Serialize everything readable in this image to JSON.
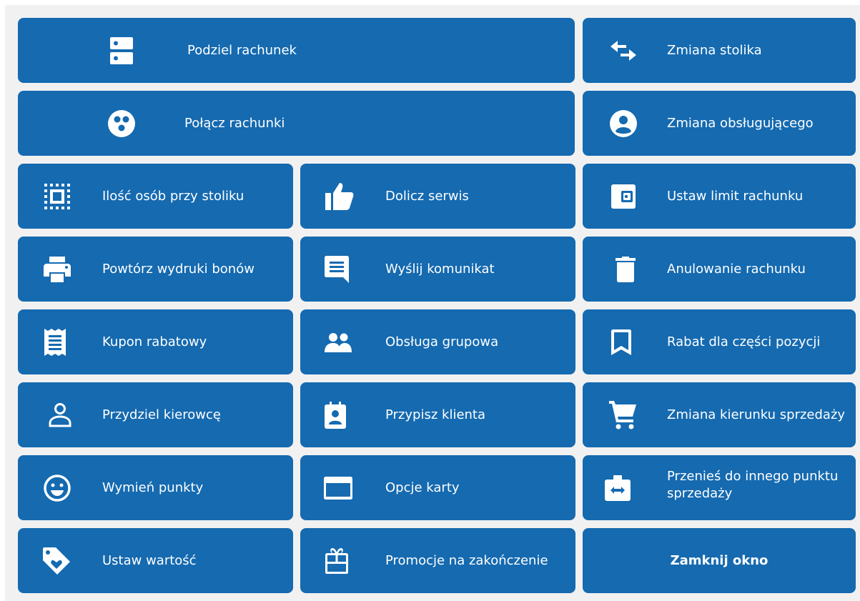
{
  "accent": "#156ab0",
  "tiles": {
    "split_bill": {
      "label": "Podziel rachunek",
      "icon": "split-bill-icon"
    },
    "change_table": {
      "label": "Zmiana stolika",
      "icon": "swap-arrows-icon"
    },
    "merge_bills": {
      "label": "Połącz rachunki",
      "icon": "merge-icon"
    },
    "change_waiter": {
      "label": "Zmiana obsługującego",
      "icon": "user-circle-icon"
    },
    "guests_count": {
      "label": "Ilość osób przy stoliku",
      "icon": "select-box-icon"
    },
    "add_service": {
      "label": "Dolicz serwis",
      "icon": "thumbs-up-icon"
    },
    "bill_limit": {
      "label": "Ustaw limit rachunku",
      "icon": "wallet-icon"
    },
    "reprint_vouchers": {
      "label": "Powtórz wydruki bonów",
      "icon": "printer-icon"
    },
    "send_message": {
      "label": "Wyślij komunikat",
      "icon": "message-icon"
    },
    "cancel_bill": {
      "label": "Anulowanie rachunku",
      "icon": "trash-icon"
    },
    "discount_coupon": {
      "label": "Kupon rabatowy",
      "icon": "receipt-icon"
    },
    "group_service": {
      "label": "Obsługa grupowa",
      "icon": "people-icon"
    },
    "partial_discount": {
      "label": "Rabat dla części pozycji",
      "icon": "bookmark-icon"
    },
    "assign_driver": {
      "label": "Przydziel kierowcę",
      "icon": "person-outline-icon"
    },
    "assign_client": {
      "label": "Przypisz klienta",
      "icon": "contact-card-icon"
    },
    "change_sale_direction": {
      "label": "Zmiana kierunku sprzedaży",
      "icon": "cart-icon"
    },
    "exchange_points": {
      "label": "Wymień punkty",
      "icon": "smiley-icon"
    },
    "card_options": {
      "label": "Opcje karty",
      "icon": "card-icon"
    },
    "move_to_point": {
      "label": "Przenieś do innego punktu sprzedaży",
      "icon": "move-case-icon"
    },
    "set_value": {
      "label": "Ustaw wartość",
      "icon": "tag-heart-icon"
    },
    "closing_promos": {
      "label": "Promocje na zakończenie",
      "icon": "gift-icon"
    },
    "close_window": {
      "label": "Zamknij okno"
    }
  }
}
